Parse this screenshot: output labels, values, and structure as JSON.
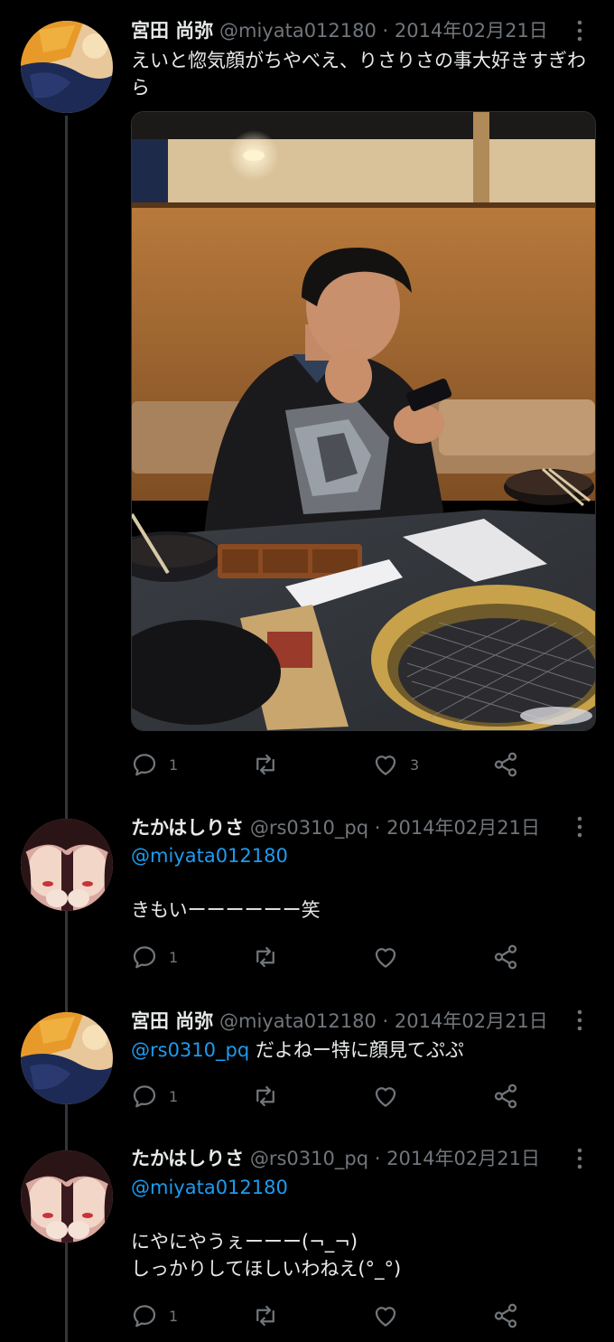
{
  "thread": [
    {
      "name": "宮田 尚弥",
      "handle": "@miyata012180",
      "separator": "·",
      "date": "2014年02月21日",
      "reply_to": "",
      "text": "えいと惚気顔がちやべえ、りさりさの事大好きすぎわら",
      "has_photo": true,
      "replies": "1",
      "retweets": "",
      "likes": "3"
    },
    {
      "name": "たかはしりさ",
      "handle": "@rs0310_pq",
      "separator": "·",
      "date": "2014年02月21日",
      "reply_to": "@miyata012180",
      "text": "きもいーーーーーー笑",
      "has_photo": false,
      "replies": "1",
      "retweets": "",
      "likes": ""
    },
    {
      "name": "宮田 尚弥",
      "handle": "@miyata012180",
      "separator": "·",
      "date": "2014年02月21日",
      "reply_to": "@rs0310_pq",
      "text": "だよねー特に顔見てぷぷ",
      "has_photo": false,
      "replies": "1",
      "retweets": "",
      "likes": ""
    },
    {
      "name": "たかはしりさ",
      "handle": "@rs0310_pq",
      "separator": "·",
      "date": "2014年02月21日",
      "reply_to": "@miyata012180",
      "text": "にやにやうぇーーー(¬_¬)\nしっかりしてほしいわねえ(°_°)",
      "has_photo": false,
      "replies": "1",
      "retweets": "",
      "likes": ""
    }
  ],
  "icons": {
    "more": "more-vertical-icon",
    "reply": "reply-icon",
    "retweet": "retweet-icon",
    "like": "heart-icon",
    "share": "share-icon"
  },
  "colors": {
    "background": "#000000",
    "text": "#e7e9ea",
    "secondary": "#71767b",
    "mention": "#1d9bf0",
    "thread_line": "#333639"
  }
}
